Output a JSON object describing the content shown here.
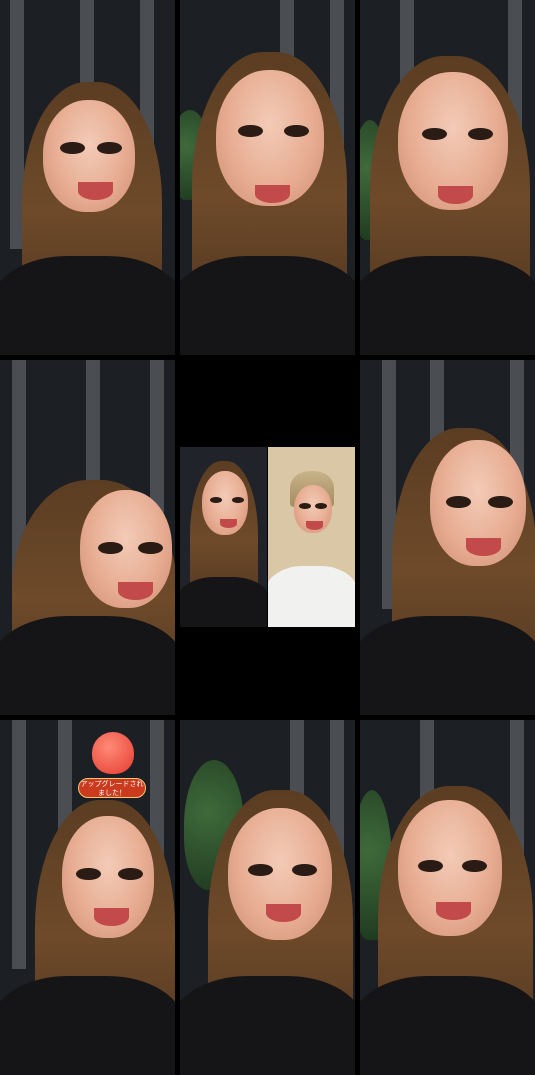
{
  "tiles": [
    {
      "name": "video-tile-1"
    },
    {
      "name": "video-tile-2"
    },
    {
      "name": "video-tile-3"
    },
    {
      "name": "video-tile-4"
    },
    {
      "name": "video-tile-5-split"
    },
    {
      "name": "video-tile-6"
    },
    {
      "name": "video-tile-7"
    },
    {
      "name": "video-tile-8"
    },
    {
      "name": "video-tile-9"
    }
  ],
  "badge": {
    "label": "アップグレードされました！",
    "icon": "heart-mascot-icon"
  },
  "colors": {
    "background": "#000000",
    "badge_fill": "#c93a1f",
    "badge_border": "#f7c66d"
  }
}
